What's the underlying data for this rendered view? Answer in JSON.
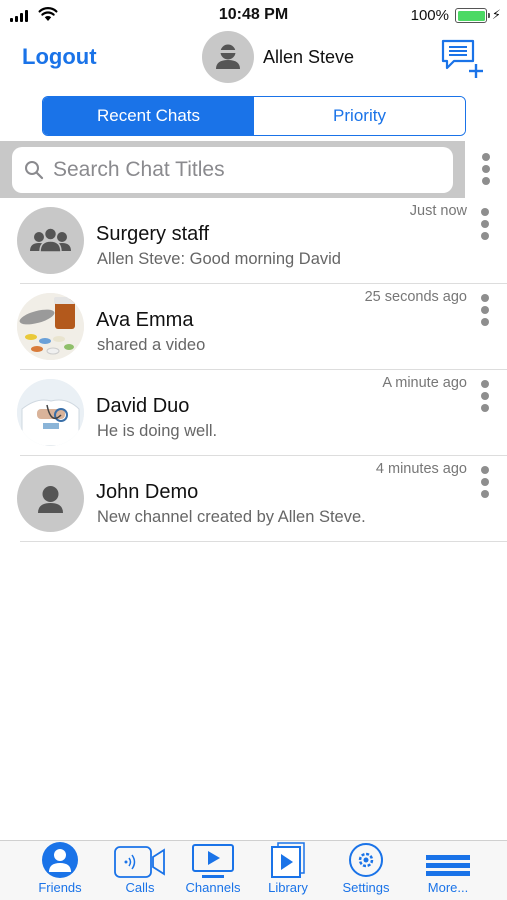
{
  "status": {
    "time": "10:48 PM",
    "battery_percent": "100%",
    "battery_level": 1.0
  },
  "header": {
    "logout_label": "Logout",
    "user_name": "Allen Steve"
  },
  "segments": {
    "recent_label": "Recent Chats",
    "priority_label": "Priority",
    "selected": "recent"
  },
  "search": {
    "placeholder": "Search Chat Titles",
    "value": ""
  },
  "chats": [
    {
      "name": "Surgery staff",
      "preview": "Allen Steve: Good morning David",
      "time": "Just now",
      "avatar": "group-avatar"
    },
    {
      "name": "Ava Emma",
      "preview": "shared a video",
      "time": "25 seconds ago",
      "avatar": "pills-photo"
    },
    {
      "name": "David Duo",
      "preview": "He is doing well.",
      "time": "A minute ago",
      "avatar": "doctor-photo"
    },
    {
      "name": "John Demo",
      "preview": "New channel created by Allen Steve.",
      "time": "4 minutes ago",
      "avatar": "person-avatar"
    }
  ],
  "tabbar": {
    "friends": "Friends",
    "calls": "Calls",
    "channels": "Channels",
    "library": "Library",
    "settings": "Settings",
    "more": "More..."
  },
  "colors": {
    "accent": "#1a73e8",
    "battery": "#4cd964",
    "avatar_bg": "#c8c8c8"
  }
}
